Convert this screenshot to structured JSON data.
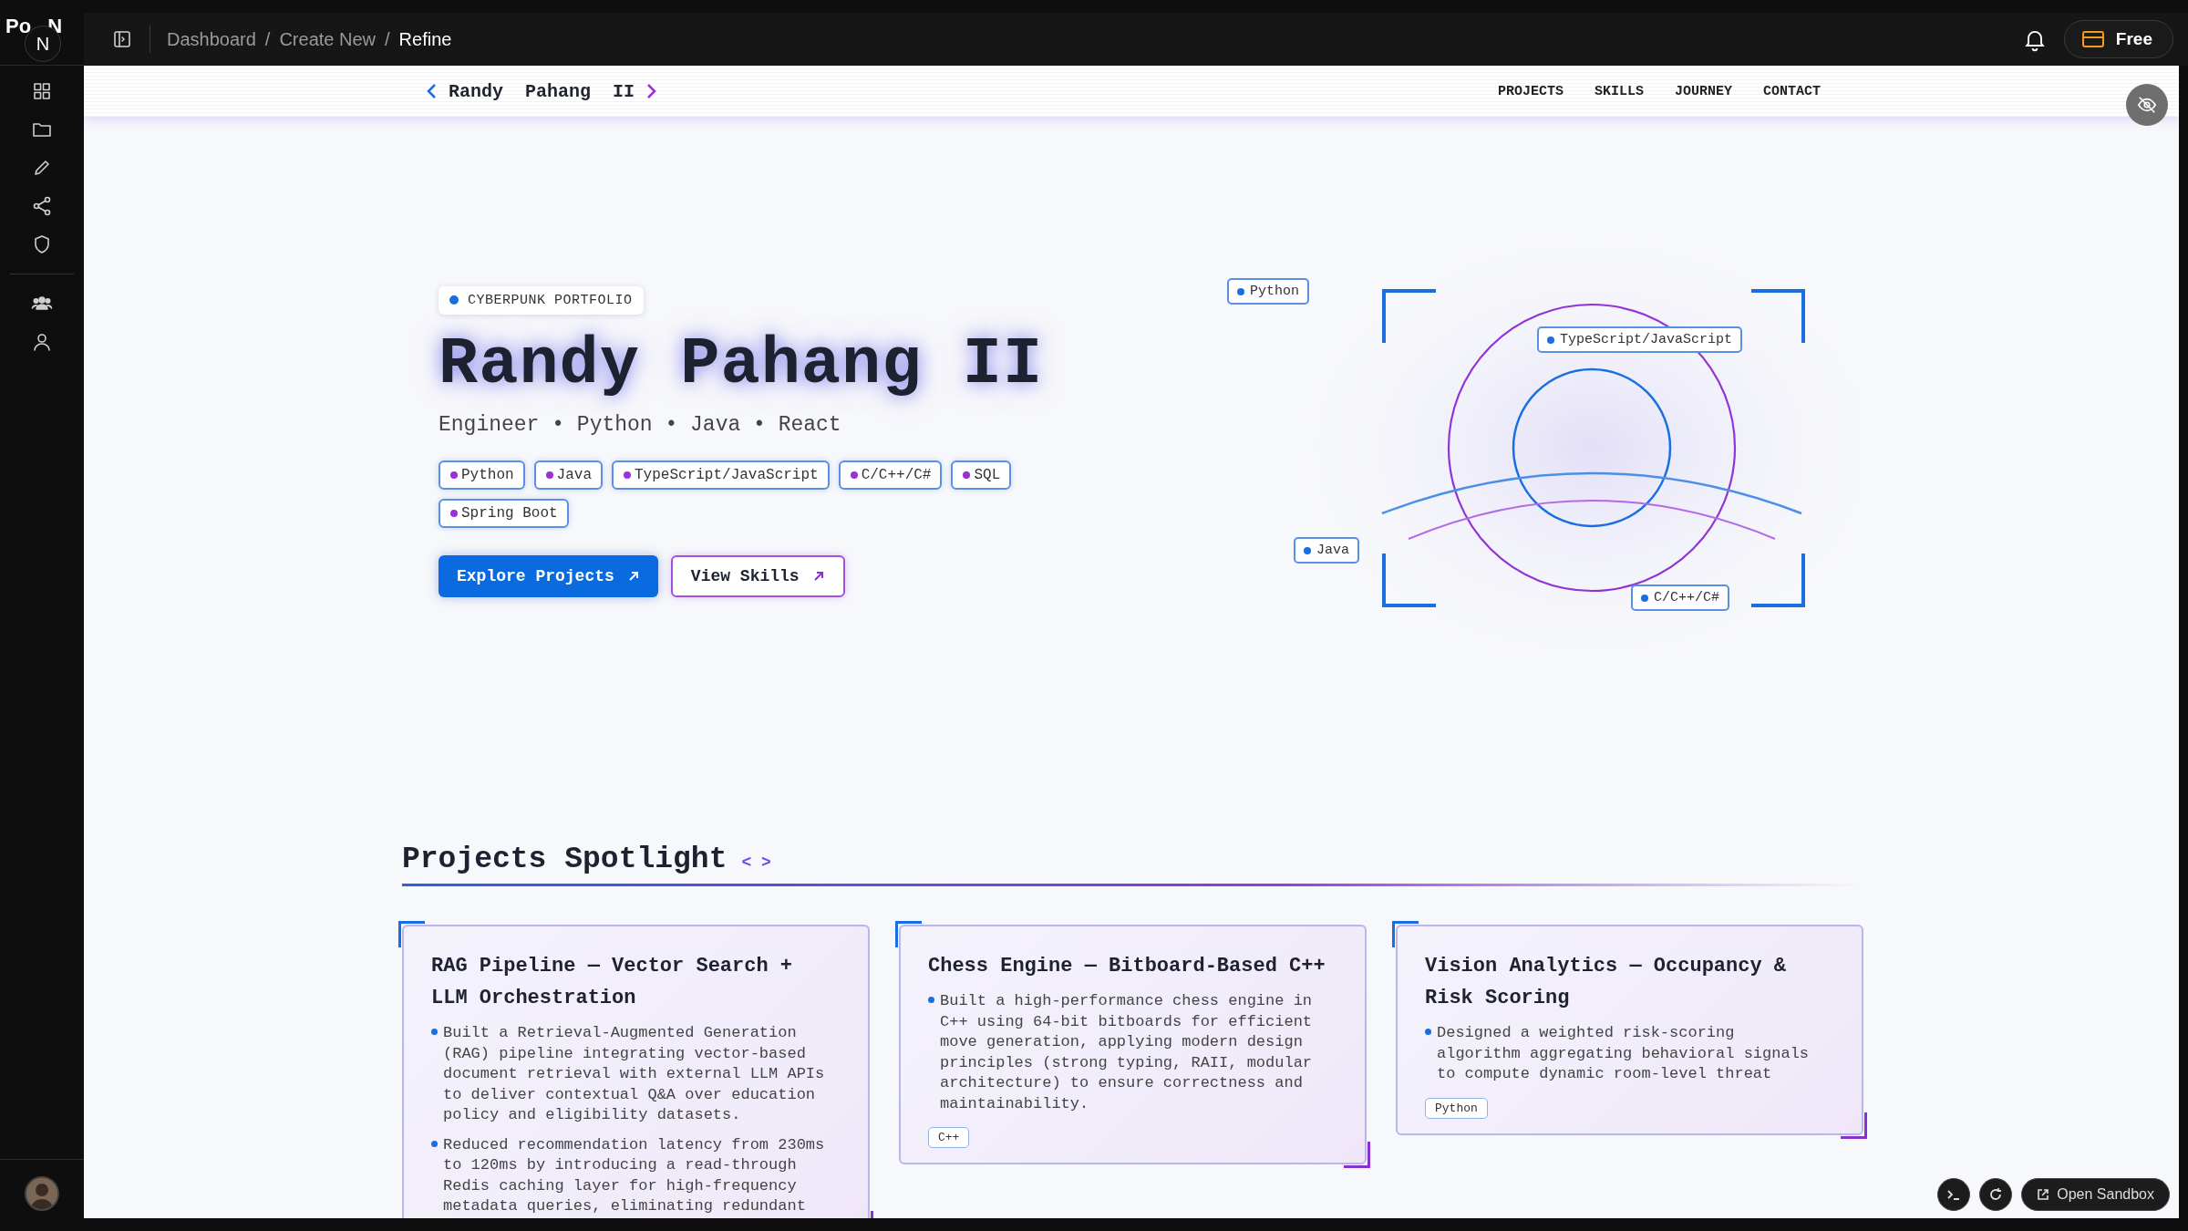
{
  "app": {
    "logo_left": "Po",
    "logo_right": "N",
    "logo_badge": "N",
    "breadcrumbs": [
      {
        "label": "Dashboard",
        "selected": false
      },
      {
        "label": "Create New",
        "selected": false,
        "separator": "/"
      },
      {
        "label": "Refine",
        "selected": true,
        "separator": "/"
      }
    ],
    "plan_button": "Free",
    "bottom_button": "Open Sandbox"
  },
  "site": {
    "brand": "Randy  Pahang  II",
    "nav": [
      "PROJECTS",
      "SKILLS",
      "JOURNEY",
      "CONTACT"
    ]
  },
  "hero": {
    "badge": "CYBERPUNK PORTFOLIO",
    "title": "Randy Pahang II",
    "subtitle": "Engineer • Python • Java • React",
    "skills": [
      "Python",
      "Java",
      "TypeScript/JavaScript",
      "C/C++/C#",
      "SQL",
      "Spring Boot"
    ],
    "buttons": [
      {
        "label": "Explore Projects",
        "kind": "primary"
      },
      {
        "label": "View Skills",
        "kind": "secondary"
      }
    ],
    "orbit_labels": [
      "Python",
      "TypeScript/JavaScript",
      "Java",
      "C/C++/C#"
    ]
  },
  "projects": {
    "heading": "Projects Spotlight",
    "heading_mark": "< >",
    "cards": [
      {
        "title": "RAG Pipeline — Vector Search + LLM Orchestration",
        "bullets": [
          "Built a Retrieval-Augmented Generation (RAG) pipeline integrating vector-based document retrieval with external LLM APIs to deliver contextual Q&A over education policy and eligibility datasets.",
          "Reduced recommendation latency from 230ms to 120ms by introducing a read-through Redis caching layer for high-frequency metadata queries, eliminating redundant"
        ]
      },
      {
        "title": "Chess Engine — Bitboard-Based C++",
        "bullets": [
          "Built a high-performance chess engine in C++ using 64-bit bitboards for efficient move generation, applying modern design principles (strong typing, RAII, modular architecture) to ensure correctness and maintainability."
        ],
        "tags": [
          "C++"
        ]
      },
      {
        "title": "Vision Analytics — Occupancy & Risk Scoring",
        "bullets": [
          "Designed a weighted risk-scoring algorithm aggregating behavioral signals to compute dynamic room-level threat"
        ],
        "tags": [
          "Python"
        ]
      }
    ]
  }
}
